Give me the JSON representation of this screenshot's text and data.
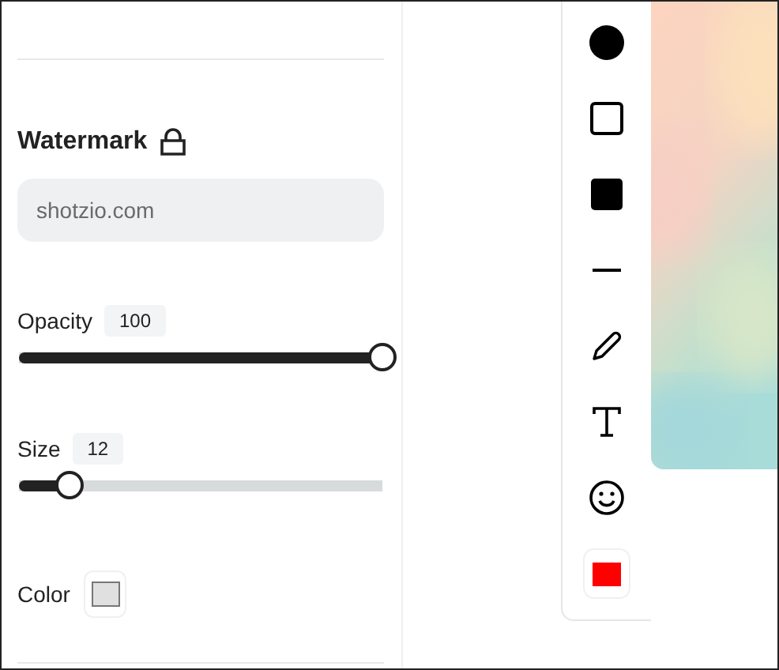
{
  "watermark_panel": {
    "title": "Watermark",
    "text_field": {
      "value": "shotzio.com"
    },
    "sliders": [
      {
        "label": "Opacity",
        "reading": "100",
        "level": 1
      },
      {
        "label": "Size",
        "reading": "12",
        "level": 0.14
      }
    ],
    "color": {
      "label": "Color",
      "color": "#e0e0e0"
    }
  },
  "toolbar": {
    "tools": [
      {
        "kind": "circle"
      },
      {
        "kind": "square"
      },
      {
        "kind": "filled-square"
      },
      {
        "kind": "line"
      },
      {
        "kind": "pencil"
      },
      {
        "kind": "text"
      },
      {
        "kind": "emoji"
      },
      {
        "kind": "color",
        "color": "#ff0000"
      }
    ]
  }
}
